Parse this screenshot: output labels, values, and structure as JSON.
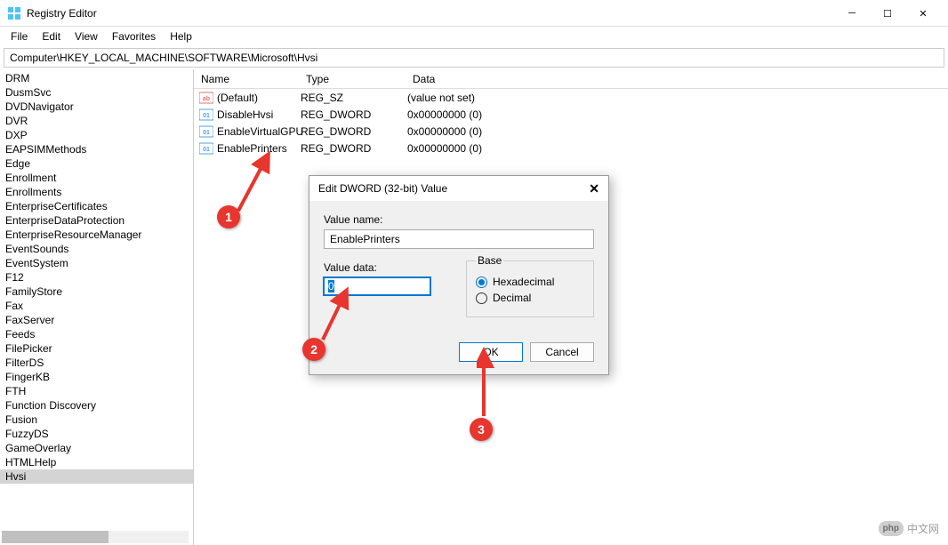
{
  "window": {
    "title": "Registry Editor"
  },
  "menubar": {
    "file": "File",
    "edit": "Edit",
    "view": "View",
    "favorites": "Favorites",
    "help": "Help"
  },
  "addressbar": {
    "path": "Computer\\HKEY_LOCAL_MACHINE\\SOFTWARE\\Microsoft\\Hvsi"
  },
  "tree": {
    "items": [
      "DRM",
      "DusmSvc",
      "DVDNavigator",
      "DVR",
      "DXP",
      "EAPSIMMethods",
      "Edge",
      "Enrollment",
      "Enrollments",
      "EnterpriseCertificates",
      "EnterpriseDataProtection",
      "EnterpriseResourceManager",
      "EventSounds",
      "EventSystem",
      "F12",
      "FamilyStore",
      "Fax",
      "FaxServer",
      "Feeds",
      "FilePicker",
      "FilterDS",
      "FingerKB",
      "FTH",
      "Function Discovery",
      "Fusion",
      "FuzzyDS",
      "GameOverlay",
      "HTMLHelp",
      "Hvsi"
    ],
    "selected": "Hvsi"
  },
  "list": {
    "headers": {
      "name": "Name",
      "type": "Type",
      "data": "Data"
    },
    "rows": [
      {
        "icon": "string",
        "name": "(Default)",
        "type": "REG_SZ",
        "data": "(value not set)"
      },
      {
        "icon": "dword",
        "name": "DisableHvsi",
        "type": "REG_DWORD",
        "data": "0x00000000 (0)"
      },
      {
        "icon": "dword",
        "name": "EnableVirtualGPU",
        "type": "REG_DWORD",
        "data": "0x00000000 (0)"
      },
      {
        "icon": "dword",
        "name": "EnablePrinters",
        "type": "REG_DWORD",
        "data": "0x00000000 (0)"
      }
    ]
  },
  "dialog": {
    "title": "Edit DWORD (32-bit) Value",
    "valueNameLabel": "Value name:",
    "valueName": "EnablePrinters",
    "valueDataLabel": "Value data:",
    "valueData": "0",
    "baseLabel": "Base",
    "hexLabel": "Hexadecimal",
    "decLabel": "Decimal",
    "okLabel": "OK",
    "cancelLabel": "Cancel"
  },
  "annotations": {
    "a1": "1",
    "a2": "2",
    "a3": "3"
  },
  "watermark": {
    "badge": "php",
    "text": "中文网"
  }
}
